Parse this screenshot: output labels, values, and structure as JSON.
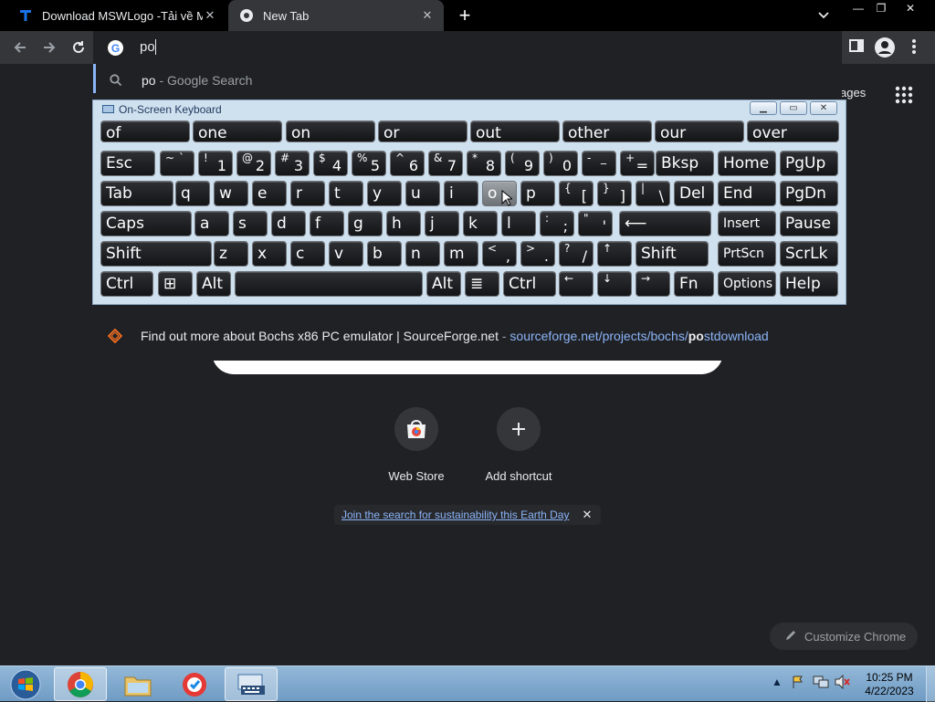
{
  "tabs": [
    {
      "title": "Download MSWLogo -Tải về Mớ",
      "favicon": "t-icon"
    },
    {
      "title": "New Tab",
      "favicon": "chrome-icon"
    }
  ],
  "omnibox": {
    "text": "po"
  },
  "suggestions": [
    {
      "query": "po",
      "separator": " - ",
      "source": "Google Search",
      "icon": "search-icon"
    },
    {
      "title": "Find out more about Bochs x86 PC emulator | SourceForge.net",
      "separator": " - ",
      "url_pre": "sourceforge.net/projects/bochs/",
      "url_bold": "po",
      "url_post": "stdownload",
      "icon": "sourceforge-icon"
    }
  ],
  "ntp": {
    "apps_label": "ages",
    "shortcuts": [
      {
        "label": "Web Store",
        "icon": "web-store-icon"
      },
      {
        "label": "Add shortcut",
        "icon": "plus-icon"
      }
    ],
    "promo_text": "Join the search for sustainability this Earth Day",
    "customize_label": "Customize Chrome"
  },
  "osk": {
    "title": "On-Screen Keyboard",
    "predictions": [
      "of",
      "one",
      "on",
      "or",
      "out",
      "other",
      "our",
      "over"
    ],
    "row1": [
      {
        "main": "Esc"
      },
      {
        "top": "~",
        "mid": "`"
      },
      {
        "top": "!",
        "bot": "1"
      },
      {
        "top": "@",
        "bot": "2"
      },
      {
        "top": "#",
        "bot": "3"
      },
      {
        "top": "$",
        "bot": "4"
      },
      {
        "top": "%",
        "bot": "5"
      },
      {
        "top": "^",
        "bot": "6"
      },
      {
        "top": "&",
        "bot": "7"
      },
      {
        "top": "*",
        "bot": "8"
      },
      {
        "top": "(",
        "bot": "9"
      },
      {
        "top": ")",
        "bot": "0"
      },
      {
        "top": "-",
        "mid": "_"
      },
      {
        "top": "+",
        "bot": "="
      },
      {
        "main": "Bksp"
      },
      {
        "main": "Home"
      },
      {
        "main": "PgUp"
      }
    ],
    "row2": [
      {
        "main": "Tab"
      },
      {
        "main": "q"
      },
      {
        "main": "w"
      },
      {
        "main": "e"
      },
      {
        "main": "r"
      },
      {
        "main": "t"
      },
      {
        "main": "y"
      },
      {
        "main": "u"
      },
      {
        "main": "i"
      },
      {
        "main": "o"
      },
      {
        "main": "p"
      },
      {
        "top": "{",
        "bot": "["
      },
      {
        "top": "}",
        "bot": "]"
      },
      {
        "top": "|",
        "bot": "\\"
      },
      {
        "main": "Del"
      },
      {
        "main": "End"
      },
      {
        "main": "PgDn"
      }
    ],
    "row3": [
      {
        "main": "Caps"
      },
      {
        "main": "a"
      },
      {
        "main": "s"
      },
      {
        "main": "d"
      },
      {
        "main": "f"
      },
      {
        "main": "g"
      },
      {
        "main": "h"
      },
      {
        "main": "j"
      },
      {
        "main": "k"
      },
      {
        "main": "l"
      },
      {
        "top": ":",
        "bot": ";"
      },
      {
        "top": "\"",
        "bot": "'"
      },
      {
        "main": "⟵"
      },
      {
        "main": "Insert"
      },
      {
        "main": "Pause"
      }
    ],
    "row4": [
      {
        "main": "Shift"
      },
      {
        "main": "z"
      },
      {
        "main": "x"
      },
      {
        "main": "c"
      },
      {
        "main": "v"
      },
      {
        "main": "b"
      },
      {
        "main": "n"
      },
      {
        "main": "m"
      },
      {
        "top": "<",
        "bot": ","
      },
      {
        "top": ">",
        "bot": "."
      },
      {
        "top": "?",
        "bot": "/"
      },
      {
        "top": "↑"
      },
      {
        "main": "Shift"
      },
      {
        "main": "PrtScn"
      },
      {
        "main": "ScrLk"
      }
    ],
    "row5": [
      {
        "main": "Ctrl"
      },
      {
        "main": "⊞"
      },
      {
        "main": "Alt"
      },
      {
        "main": ""
      },
      {
        "main": "Alt"
      },
      {
        "main": "≣"
      },
      {
        "main": "Ctrl"
      },
      {
        "top": "←"
      },
      {
        "top": "↓"
      },
      {
        "top": "→"
      },
      {
        "main": "Fn"
      },
      {
        "main": "Options"
      },
      {
        "main": "Help"
      }
    ]
  },
  "taskbar": {
    "time": "10:25 PM",
    "date": "4/22/2023"
  },
  "colors": {
    "accent": "#8ab4f8",
    "bg": "#202124",
    "toolbar": "#35363a"
  }
}
